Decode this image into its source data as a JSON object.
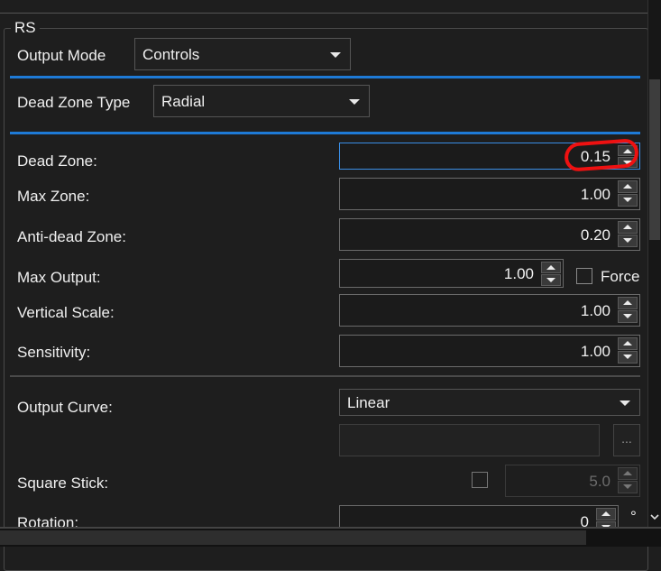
{
  "group": {
    "title": "RS"
  },
  "output_mode": {
    "label": "Output Mode",
    "value": "Controls"
  },
  "dead_zone_type": {
    "label": "Dead Zone Type",
    "value": "Radial"
  },
  "fields": {
    "dead_zone": {
      "label": "Dead Zone:",
      "value": "0.15"
    },
    "max_zone": {
      "label": "Max Zone:",
      "value": "1.00"
    },
    "anti_dead_zone": {
      "label": "Anti-dead Zone:",
      "value": "0.20"
    },
    "max_output": {
      "label": "Max Output:",
      "value": "1.00",
      "force_label": "Force"
    },
    "vertical_scale": {
      "label": "Vertical Scale:",
      "value": "1.00"
    },
    "sensitivity": {
      "label": "Sensitivity:",
      "value": "1.00"
    }
  },
  "output_curve": {
    "label": "Output Curve:",
    "value": "Linear",
    "dots_label": "..."
  },
  "square_stick": {
    "label": "Square Stick:",
    "value": "5.0"
  },
  "rotation": {
    "label": "Rotation:",
    "value": "0",
    "unit": "°"
  },
  "colors": {
    "accent": "#1e7ad6",
    "annotation": "#e11111",
    "background": "#1e1e1e"
  }
}
